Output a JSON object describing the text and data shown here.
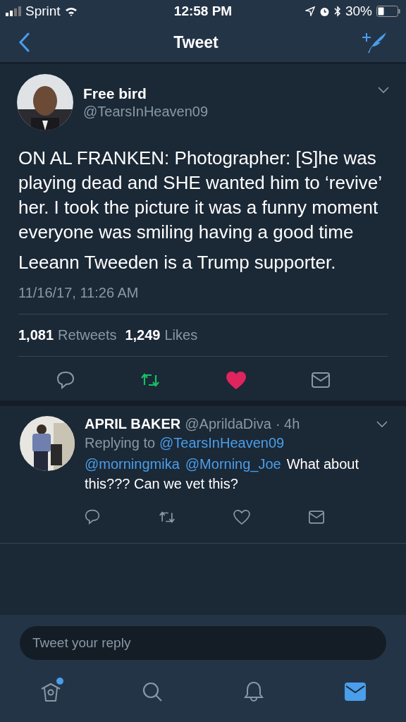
{
  "status_bar": {
    "carrier": "Sprint",
    "time": "12:58 PM",
    "battery": "30%"
  },
  "nav": {
    "title": "Tweet"
  },
  "tweet": {
    "name": "Free bird",
    "handle": "@TearsInHeaven09",
    "paragraphs": [
      "ON AL FRANKEN: Photographer: [S]he was playing dead and SHE wanted him to ‘revive’ her. I took the picture it was a funny moment everyone was smiling having a good time",
      "Leeann Tweeden is a Trump supporter."
    ],
    "timestamp": "11/16/17, 11:26 AM",
    "retweets": "1,081",
    "retweets_label": "Retweets",
    "likes": "1,249",
    "likes_label": "Likes",
    "liked": true
  },
  "reply": {
    "name": "APRIL BAKER",
    "handle": "@AprildaDiva",
    "time": "· 4h",
    "replying_label": "Replying to",
    "replying_to": "@TearsInHeaven09",
    "mentions": [
      "@morningmika",
      "@Morning_Joe"
    ],
    "text": "What about this??? Can we vet this?",
    "liked": false
  },
  "compose": {
    "placeholder": "Tweet your reply"
  },
  "tabs": [
    {
      "kind": "home",
      "selected": false,
      "badge": true
    },
    {
      "kind": "search",
      "selected": false,
      "badge": false
    },
    {
      "kind": "notifications",
      "selected": false,
      "badge": false
    },
    {
      "kind": "messages",
      "selected": true,
      "badge": false
    }
  ]
}
